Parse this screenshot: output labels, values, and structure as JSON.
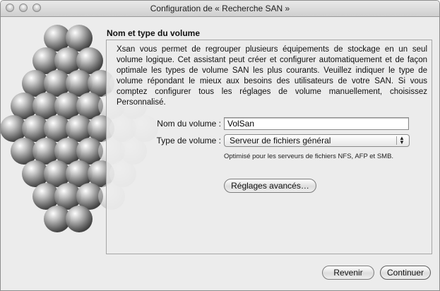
{
  "window": {
    "title": "Configuration de « Recherche SAN »"
  },
  "section": {
    "heading": "Nom et type du volume",
    "description": "Xsan vous permet de regrouper plusieurs équipements de stockage en un seul volume logique. Cet assistant peut créer et configurer automatiquement et de façon optimale les types de volume SAN les plus courants. Veuillez indiquer le type de volume répondant le mieux aux besoins des utilisateurs de votre SAN. Si vous comptez configurer tous les réglages de volume manuellement, choisissez Personnalisé."
  },
  "form": {
    "volume_name_label": "Nom du volume :",
    "volume_name_value": "VolSan",
    "volume_type_label": "Type de volume :",
    "volume_type_value": "Serveur de fichiers général",
    "volume_type_hint": "Optimisé pour les serveurs de fichiers NFS, AFP et SMB.",
    "advanced_button": "Réglages avancés…"
  },
  "footer": {
    "back_button": "Revenir",
    "continue_button": "Continuer"
  }
}
